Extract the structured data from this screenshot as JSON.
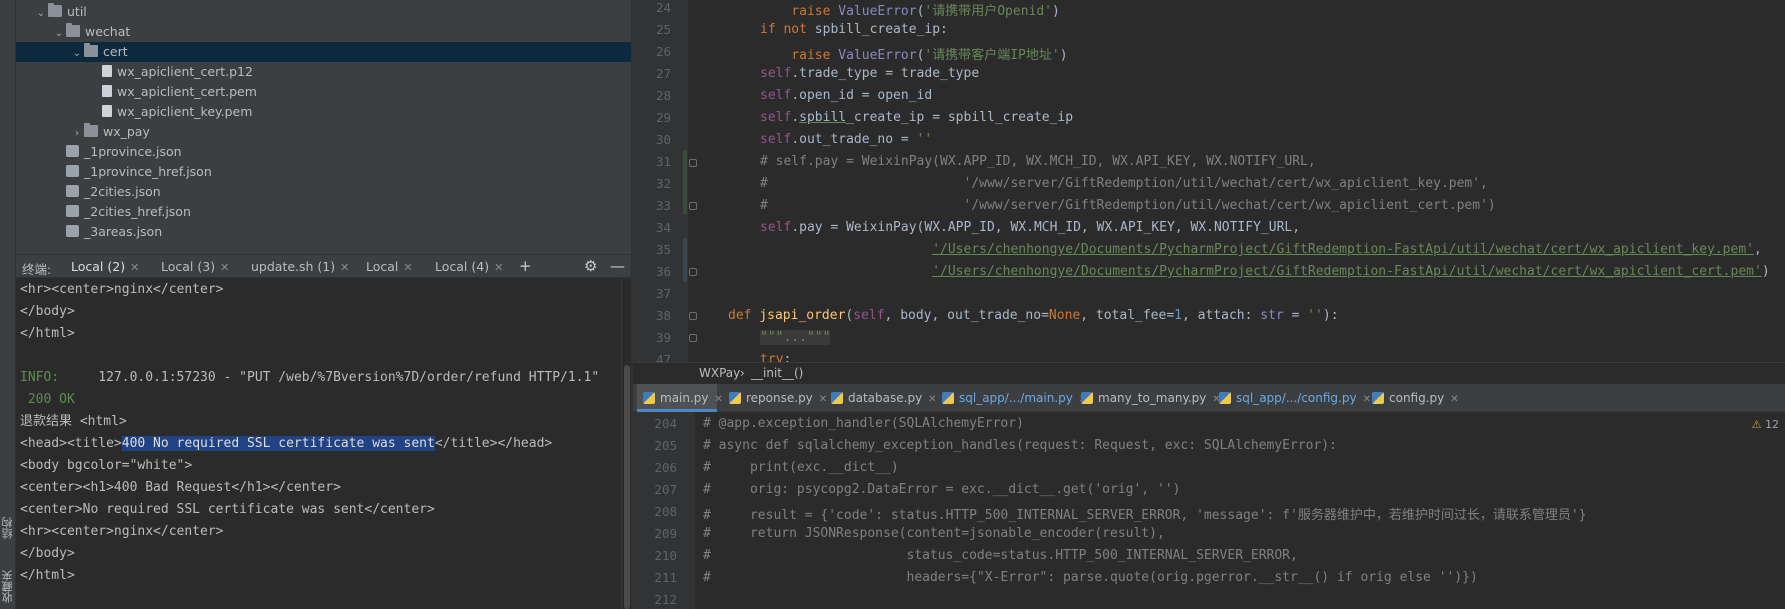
{
  "left_strip": {
    "tab_structure": "结构",
    "tab_bookmarks": "收藏夹"
  },
  "project_tree": [
    {
      "label": "util",
      "type": "folder",
      "expanded": true,
      "indent": 1
    },
    {
      "label": "wechat",
      "type": "folder",
      "expanded": true,
      "indent": 2
    },
    {
      "label": "cert",
      "type": "folder",
      "expanded": true,
      "indent": 3,
      "selected": true
    },
    {
      "label": "wx_apiclient_cert.p12",
      "type": "file",
      "indent": 4
    },
    {
      "label": "wx_apiclient_cert.pem",
      "type": "file",
      "indent": 4
    },
    {
      "label": "wx_apiclient_key.pem",
      "type": "file",
      "indent": 4
    },
    {
      "label": "wx_pay",
      "type": "folder",
      "expanded": false,
      "indent": 3
    },
    {
      "label": "_1province.json",
      "type": "json",
      "indent": 2
    },
    {
      "label": "_1province_href.json",
      "type": "json",
      "indent": 2
    },
    {
      "label": "_2cities.json",
      "type": "json",
      "indent": 2
    },
    {
      "label": "_2cities_href.json",
      "type": "json",
      "indent": 2
    },
    {
      "label": "_3areas.json",
      "type": "json",
      "indent": 2
    }
  ],
  "terminal_tabs": {
    "label": "终端:",
    "tabs": [
      "Local (2)",
      "Local (3)",
      "update.sh (1)",
      "Local",
      "Local (4)"
    ],
    "active_index": 0
  },
  "terminal": {
    "lines": [
      "<hr><center>nginx</center>",
      "</body>",
      "</html>",
      "",
      "",
      " 200 OK",
      "退款结果 <html>",
      "",
      "<body bgcolor=\"white\">",
      "<center><h1>400 Bad Request</h1></center>",
      "<center>No required SSL certificate was sent</center>",
      "<hr><center>nginx</center>",
      "</body>",
      "</html>"
    ],
    "info_label": "INFO:",
    "info_text": "127.0.0.1:57230 - \"PUT /web/%7Bversion%7D/order/refund HTTP/1.1\"",
    "head_prefix": "<head><title>",
    "head_highlight": "400 No required SSL certificate was sent",
    "head_suffix": "</title></head>"
  },
  "top_editor": {
    "line_numbers": [
      "24",
      "25",
      "26",
      "27",
      "28",
      "29",
      "30",
      "31",
      "32",
      "33",
      "34",
      "35",
      "36",
      "37",
      "38",
      "39",
      "47"
    ],
    "l24_str": "'请携带用户Openid'",
    "l26_str": "'请携带客户端IP地址'",
    "l32_cmt": "#                         '/www/server/GiftRedemption/util/wechat/cert/wx_apiclient_key.pem',",
    "l33_cmt": "#                         '/www/server/GiftRedemption/util/wechat/cert/wx_apiclient_cert.pem')",
    "l31_cmt": "# self.pay = WeixinPay(WX.APP_ID, WX.MCH_ID, WX.API_KEY, WX.NOTIFY_URL,",
    "l35_str": "'/Users/chenhongye/Documents/PycharmProject/GiftRedemption-FastApi/util/wechat/cert/wx_apiclient_key.pem'",
    "l36_str": "'/Users/chenhongye/Documents/PycharmProject/GiftRedemption-FastApi/util/wechat/cert/wx_apiclient_cert.pem'",
    "l39_doc": "\"\"\"...\"\"\""
  },
  "breadcrumb": {
    "cls": "WXPay",
    "sep": "›",
    "method": "__init__()"
  },
  "file_tabs": [
    "main.py",
    "reponse.py",
    "database.py",
    "sql_app/.../main.py",
    "many_to_many.py",
    "sql_app/.../config.py",
    "config.py"
  ],
  "bottom_editor": {
    "line_numbers": [
      "204",
      "205",
      "206",
      "207",
      "208",
      "209",
      "210",
      "211",
      "212"
    ],
    "lines": [
      "# @app.exception_handler(SQLAlchemyError)",
      "# async def sqlalchemy_exception_handles(request: Request, exc: SQLAlchemyError):",
      "#     print(exc.__dict__)",
      "#     orig: psycopg2.DataError = exc.__dict__.get('orig', '')",
      "#     result = {'code': status.HTTP_500_INTERNAL_SERVER_ERROR, 'message': f'服务器维护中，若维护时间过长，请联系管理员'}",
      "#     return JSONResponse(content=jsonable_encoder(result),",
      "#                         status_code=status.HTTP_500_INTERNAL_SERVER_ERROR,",
      "#                         headers={\"X-Error\": parse.quote(orig.pgerror.__str__() if orig else '')})",
      ""
    ],
    "warning_count": "12"
  },
  "colors": {
    "selection": "#0d293e",
    "keyword": "#cc7832",
    "string": "#6a8759",
    "comment": "#808080"
  }
}
